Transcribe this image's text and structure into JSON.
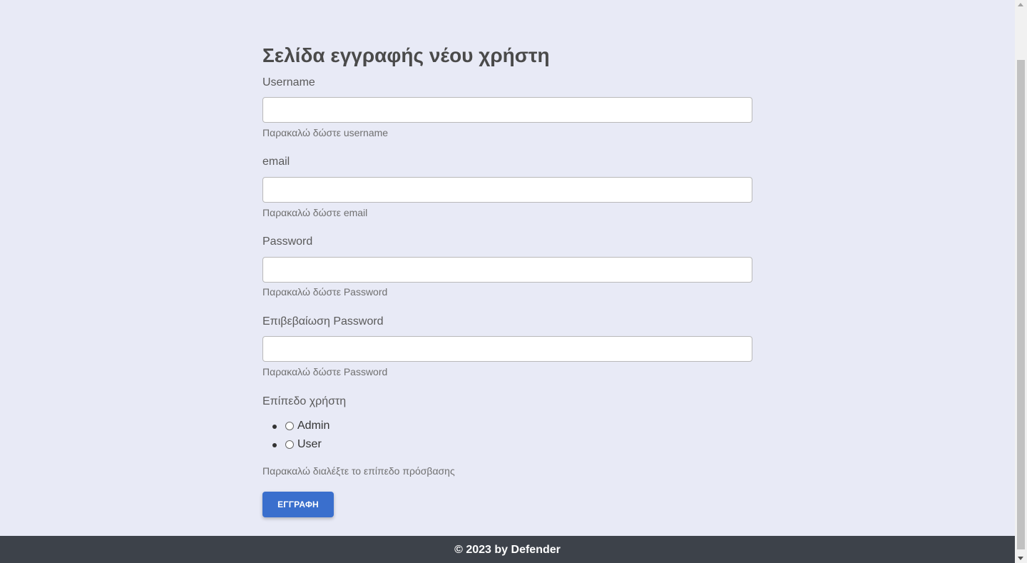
{
  "form": {
    "title": "Σελίδα εγγραφής νέου χρήστη",
    "username": {
      "label": "Username",
      "value": "",
      "hint": "Παρακαλώ δώστε username"
    },
    "email": {
      "label": "email",
      "value": "",
      "hint": "Παρακαλώ δώστε email"
    },
    "password": {
      "label": "Password",
      "value": "",
      "hint": "Παρακαλώ δώστε Password"
    },
    "confirm_password": {
      "label": "Επιβεβαίωση Password",
      "value": "",
      "hint": "Παρακαλώ δώστε Password"
    },
    "user_level": {
      "label": "Επίπεδο χρήστη",
      "options": [
        "Admin",
        "User"
      ],
      "selected": null,
      "hint": "Παρακαλώ διαλέξτε το επίπεδο πρόσβασης"
    },
    "submit_label": "ΕΓΓΡΑΦΗ"
  },
  "footer": {
    "text": "© 2023 by Defender"
  },
  "colors": {
    "page_background": "#e8eaf6",
    "button": "#3a6fcd",
    "footer": "#3d424a"
  }
}
